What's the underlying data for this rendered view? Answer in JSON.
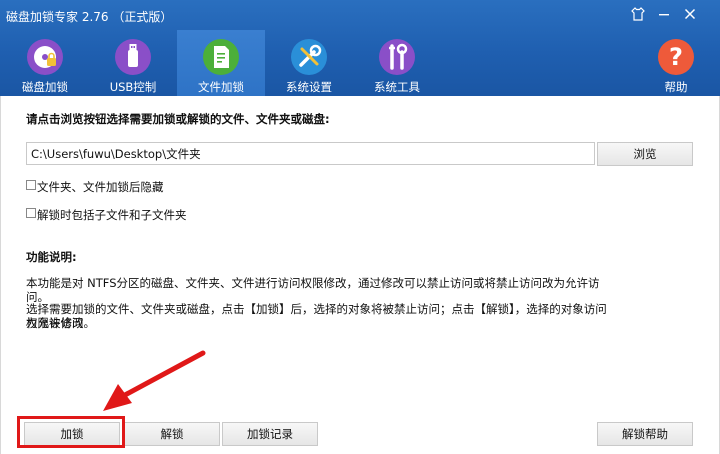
{
  "window": {
    "title": "磁盘加锁专家 2.76 （正式版）",
    "controls": [
      "shirt-icon",
      "minimize-icon",
      "close-icon"
    ]
  },
  "nav": {
    "tabs": [
      {
        "label": "磁盘加锁",
        "icon": "disk-lock-icon",
        "active": false
      },
      {
        "label": "USB控制",
        "icon": "usb-icon",
        "active": false
      },
      {
        "label": "文件加锁",
        "icon": "file-lock-icon",
        "active": true
      },
      {
        "label": "系统设置",
        "icon": "settings-tools-icon",
        "active": false
      },
      {
        "label": "系统工具",
        "icon": "tools-icon",
        "active": false
      }
    ],
    "help": {
      "label": "帮助",
      "icon": "help-icon"
    }
  },
  "main": {
    "prompt": "请点击浏览按钮选择需要加锁或解锁的文件、文件夹或磁盘:",
    "path_value": "C:\\Users\\fuwu\\Desktop\\文件夹",
    "browse_label": "浏览",
    "checkboxes": [
      {
        "label": "文件夹、文件加锁后隐藏",
        "checked": false
      },
      {
        "label": "解锁时包括子文件和子文件夹",
        "checked": false
      }
    ],
    "section_title": "功能说明:",
    "desc1": "本功能是对 NTFS分区的磁盘、文件夹、文件进行访问权限修改，通过修改可以禁止访问或将禁止访问改为允许访问。",
    "desc2_line1": "选择需要加锁的文件、文件夹或磁盘，点击【加锁】后，选择的对象将被禁止访问；点击【解锁】，选择的对象访问权限被修改",
    "desc2_line2": "为允许访问。"
  },
  "buttons": {
    "lock": "加锁",
    "unlock": "解锁",
    "lock_log": "加锁记录",
    "unlock_help": "解锁帮助"
  },
  "colors": {
    "header": "#1f5fb0",
    "highlight": "#e01818"
  }
}
